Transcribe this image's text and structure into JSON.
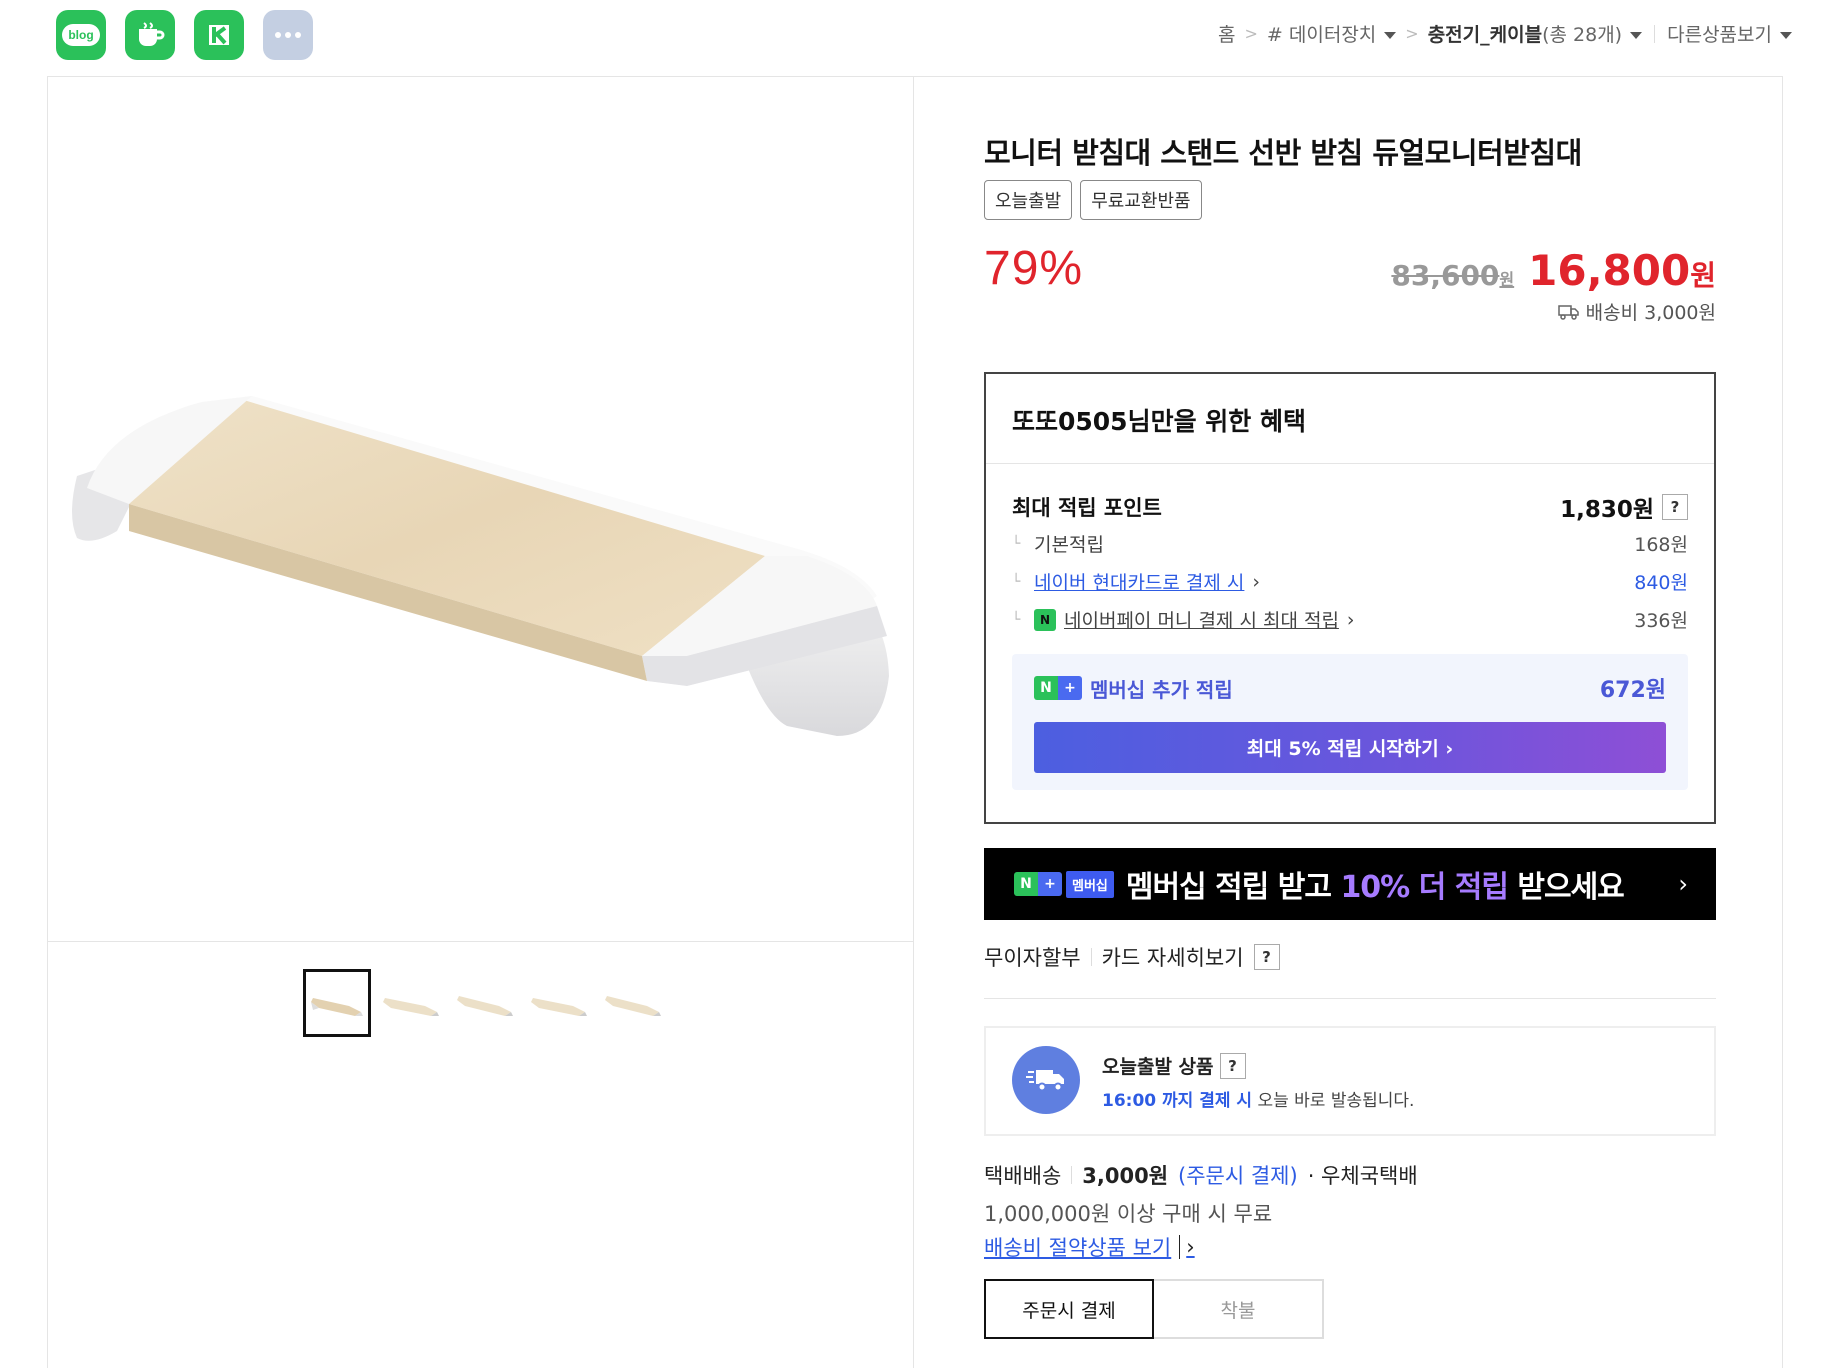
{
  "share": {
    "blog_label": "blog",
    "icons": [
      "blog-icon",
      "cafe-icon",
      "kin-icon",
      "more-icon"
    ]
  },
  "breadcrumb": {
    "home": "홈",
    "sep": ">",
    "cat1": "# 데이터장치",
    "cat2_name": "충전기_케이블",
    "cat2_count": "(총 28개)",
    "more": "다른상품보기"
  },
  "product": {
    "title": "모니터 받침대 스탠드 선반 받침 듀얼모니터받침대",
    "badges": [
      "오늘출발",
      "무료교환반품"
    ],
    "discount": "79%",
    "original_price": "83,600",
    "original_won": "원",
    "sale_price": "16,800",
    "sale_won": "원",
    "shipping_fee": "배송비 3,000원"
  },
  "benefit": {
    "title": "또또0505님만을 위한 혜택",
    "max_points_label": "최대 적립 포인트",
    "max_points_value": "1,830원",
    "help": "?",
    "tree": "└",
    "rows": [
      {
        "label": "기본적립",
        "value": "168원"
      },
      {
        "label": "네이버 현대카드로 결제 시",
        "value": "840원"
      },
      {
        "label": "네이버페이 머니 결제 시 최대 적립",
        "value": "336원"
      }
    ],
    "npay_glyph": "N",
    "chevron": "›",
    "membership_n": "N",
    "membership_plus": "+",
    "membership_label": "멤버십 추가 적립",
    "membership_value": "672원",
    "membership_button": "최대 5% 적립 시작하기 ›"
  },
  "banner": {
    "n": "N",
    "plus": "+",
    "tag": "멤버십",
    "text_a": "멤버십 적립 받고 ",
    "text_hl": "10% 더 적립",
    "text_b": " 받으세요",
    "chevron": "›"
  },
  "installment": {
    "label": "무이자할부",
    "card_link": "카드 자세히보기",
    "help": "?"
  },
  "today": {
    "title": "오늘출발 상품",
    "help": "?",
    "deadline": "16:00 까지 결제 시",
    "note": " 오늘 바로 발송됩니다."
  },
  "delivery": {
    "type": "택배배송",
    "amount": "3,000원",
    "pay_when": "(주문시 결제)",
    "carrier": "· 우체국택배",
    "free_condition": "1,000,000원 이상 구매 시 무료",
    "save_link": "배송비 절약상품 보기",
    "save_chevron": "›",
    "options": [
      "주문시 결제",
      "착불"
    ]
  },
  "colors": {
    "accent_red": "#e0242c",
    "naver_green": "#2bc15a",
    "link_blue": "#2d5be3",
    "membership_purple": "#6d55dc"
  }
}
